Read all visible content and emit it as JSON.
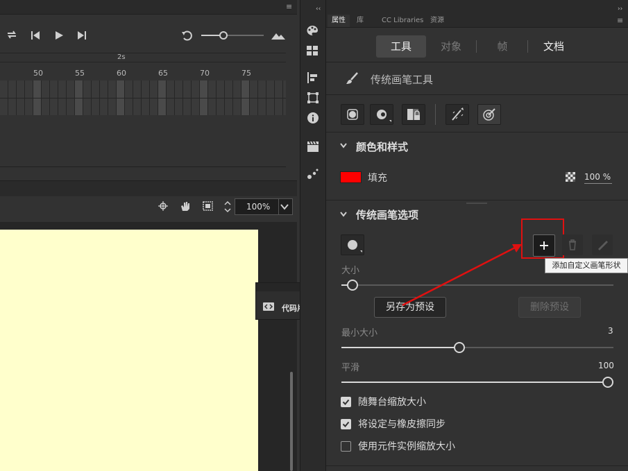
{
  "timeline": {
    "ruler_seconds_label": "2s",
    "frame_numbers": [
      "50",
      "55",
      "60",
      "65",
      "70",
      "75"
    ],
    "zoom_percent": "100%"
  },
  "properties": {
    "tabs": [
      "属性",
      "库",
      "CC Libraries",
      "资源"
    ],
    "active_tab": "属性",
    "segments": [
      "工具",
      "对象",
      "帧",
      "文档"
    ],
    "active_segment": "工具",
    "tool_name": "传统画笔工具",
    "section_color_style": "颜色和样式",
    "fill_label": "填充",
    "fill_color": "#ff0000",
    "fill_alpha": "100 %",
    "section_brush_options": "传统画笔选项",
    "add_shape_tooltip": "添加自定义画笔形状",
    "size_label": "大小",
    "size_value_fraction": 0.02,
    "save_preset_label": "另存为预设",
    "delete_preset_label": "删除预设",
    "min_size_label": "最小大小",
    "min_size_value": "3",
    "min_size_fraction": 0.43,
    "smooth_label": "平滑",
    "smooth_value": "100",
    "smooth_fraction": 1.0,
    "checkboxes": [
      {
        "label": "随舞台缩放大小",
        "checked": true
      },
      {
        "label": "将设定与橡皮擦同步",
        "checked": true
      },
      {
        "label": "使用元件实例缩放大小",
        "checked": false
      }
    ]
  },
  "snippet_panel": {
    "title": "代码片断"
  },
  "colors": {
    "highlight": "#e01010",
    "canvas": "#ffffcc"
  }
}
